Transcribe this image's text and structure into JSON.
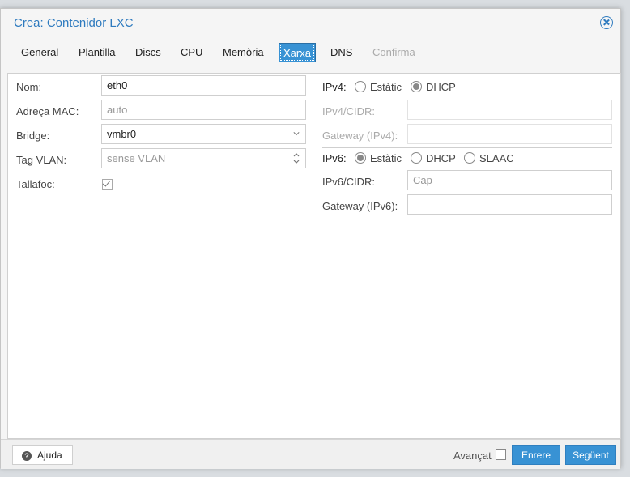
{
  "window": {
    "title": "Crea: Contenidor LXC"
  },
  "tabs": [
    {
      "label": "General"
    },
    {
      "label": "Plantilla"
    },
    {
      "label": "Discs"
    },
    {
      "label": "CPU"
    },
    {
      "label": "Memòria"
    },
    {
      "label": "Xarxa"
    },
    {
      "label": "DNS"
    },
    {
      "label": "Confirma"
    }
  ],
  "active_tab": "Xarxa",
  "left": {
    "name": {
      "label": "Nom:",
      "value": "eth0"
    },
    "mac": {
      "label": "Adreça MAC:",
      "placeholder": "auto"
    },
    "bridge": {
      "label": "Bridge:",
      "value": "vmbr0"
    },
    "vlan": {
      "label": "Tag VLAN:",
      "placeholder": "sense VLAN"
    },
    "firewall": {
      "label": "Tallafoc:",
      "checked": true
    }
  },
  "right": {
    "ipv4": {
      "label": "IPv4:",
      "static_label": "Estàtic",
      "dhcp_label": "DHCP",
      "selected": "DHCP"
    },
    "ipv4_cidr": {
      "label": "IPv4/CIDR:",
      "value": ""
    },
    "gateway4": {
      "label": "Gateway (IPv4):",
      "value": ""
    },
    "ipv6": {
      "label": "IPv6:",
      "static_label": "Estàtic",
      "dhcp_label": "DHCP",
      "slaac_label": "SLAAC",
      "selected": "Estàtic"
    },
    "ipv6_cidr": {
      "label": "IPv6/CIDR:",
      "placeholder": "Cap"
    },
    "gateway6": {
      "label": "Gateway (IPv6):",
      "value": ""
    }
  },
  "footer": {
    "help_label": "Ajuda",
    "advanced_label": "Avançat",
    "advanced_checked": false,
    "back_label": "Enrere",
    "next_label": "Següent"
  },
  "colors": {
    "accent": "#3892d4",
    "title": "#2f7bbf"
  }
}
